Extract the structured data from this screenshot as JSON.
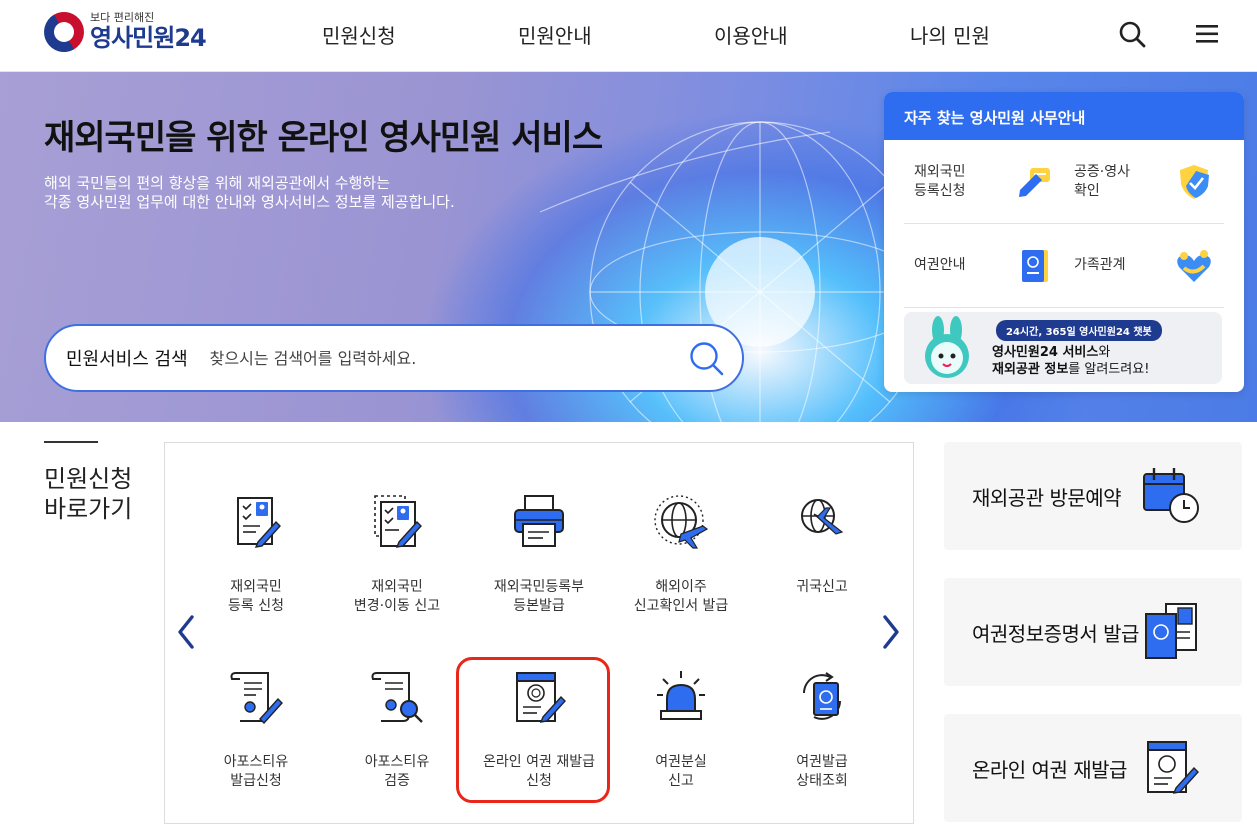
{
  "header": {
    "logo_sub": "보다 편리해진",
    "logo_main": "영사민원24",
    "nav": [
      "민원신청",
      "민원안내",
      "이용안내",
      "나의 민원"
    ]
  },
  "hero": {
    "title": "재외국민을 위한 온라인 영사민원 서비스",
    "desc_line1": "해외 국민들의 편의 향상을 위해 재외공관에서 수행하는",
    "desc_line2": "각종 영사민원 업무에 대한 안내와 영사서비스 정보를 제공합니다.",
    "search_label": "민원서비스 검색",
    "search_placeholder": "찾으시는 검색어를 입력하세요."
  },
  "quick": {
    "title": "자주 찾는 영사민원 사무안내",
    "items": [
      {
        "line1": "재외국민",
        "line2": "등록신청",
        "icon": "pen-chat-icon"
      },
      {
        "line1": "공증·영사",
        "line2": "확인",
        "icon": "shield-check-icon"
      },
      {
        "line1": "여권안내",
        "line2": "",
        "icon": "passport-icon"
      },
      {
        "line1": "가족관계",
        "line2": "",
        "icon": "family-heart-icon"
      }
    ],
    "chatbot_badge": "24시간, 365일 영사민원24 챗봇",
    "chatbot_line1_bold": "영사민원24 서비스",
    "chatbot_line1_rest": "와",
    "chatbot_line2_bold": "재외공관 정보",
    "chatbot_line2_rest": "를 알려드려요!"
  },
  "shortcuts": {
    "title_line1": "민원신청",
    "title_line2": "바로가기",
    "items": [
      {
        "line1": "재외국민",
        "line2": "등록 신청"
      },
      {
        "line1": "재외국민",
        "line2": "변경·이동 신고"
      },
      {
        "line1": "재외국민등록부",
        "line2": "등본발급"
      },
      {
        "line1": "해외이주",
        "line2": "신고확인서 발급"
      },
      {
        "line1": "귀국신고",
        "line2": ""
      },
      {
        "line1": "아포스티유",
        "line2": "발급신청"
      },
      {
        "line1": "아포스티유",
        "line2": "검증"
      },
      {
        "line1": "온라인 여권 재발급",
        "line2": "신청"
      },
      {
        "line1": "여권분실",
        "line2": "신고"
      },
      {
        "line1": "여권발급",
        "line2": "상태조회"
      }
    ]
  },
  "side_cards": [
    "재외공관 방문예약",
    "여권정보증명서 발급",
    "온라인 여권 재발급"
  ],
  "colors": {
    "brand_blue": "#2e6df0",
    "navy": "#1f3b8f",
    "highlight_red": "#e8271a"
  }
}
